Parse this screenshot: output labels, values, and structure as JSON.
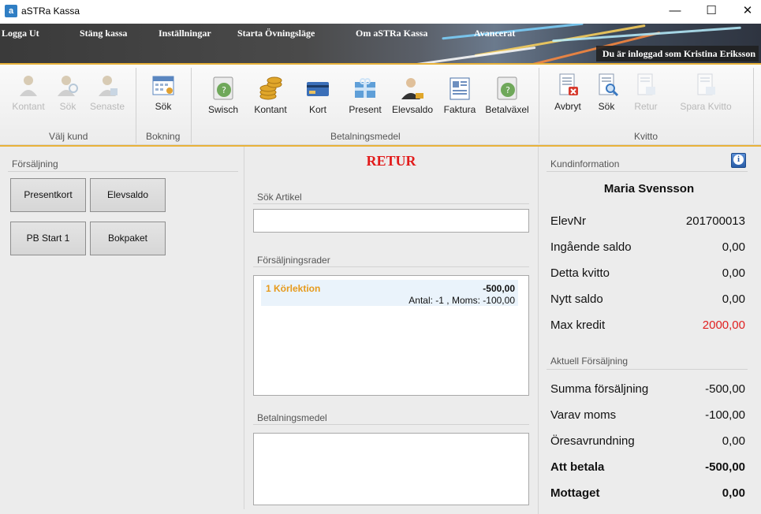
{
  "window": {
    "title": "aSTRa Kassa",
    "app_icon_letter": "a",
    "minimize": "—",
    "maximize": "☐",
    "close": "✕"
  },
  "menu": {
    "items": [
      "Logga Ut",
      "Stäng kassa",
      "Inställningar",
      "Starta Övningsläge",
      "Om aSTRa Kassa",
      "Avancerat"
    ],
    "login_info": "Du är inloggad som Kristina Eriksson"
  },
  "ribbon": {
    "valj_kund": {
      "label": "Välj kund",
      "buttons": [
        "Kontant",
        "Sök",
        "Senaste"
      ]
    },
    "bokning": {
      "label": "Bokning",
      "buttons": [
        "Sök"
      ]
    },
    "betalningsmedel": {
      "label": "Betalningsmedel",
      "buttons": [
        "Swisch",
        "Kontant",
        "Kort",
        "Present",
        "Elevsaldo",
        "Faktura",
        "Betalväxel"
      ]
    },
    "kvitto": {
      "label": "Kvitto",
      "buttons": [
        "Avbryt",
        "Sök",
        "Retur",
        "Spara Kvitto"
      ]
    }
  },
  "sales": {
    "title": "Försäljning",
    "buttons": [
      "Presentkort",
      "Elevsaldo",
      "PB Start 1",
      "Bokpaket"
    ]
  },
  "center": {
    "mode": "RETUR",
    "search_title": "Sök Artikel",
    "search_value": "",
    "rows_title": "Försäljningsrader",
    "rows": [
      {
        "name": "1 Körlektion",
        "amount": "-500,00",
        "detail": "Antal: -1 , Moms: -100,00"
      }
    ],
    "payment_title": "Betalningsmedel"
  },
  "customer": {
    "title": "Kundinformation",
    "name": "Maria Svensson",
    "fields": [
      {
        "label": "ElevNr",
        "value": "201700013"
      },
      {
        "label": "Ingående saldo",
        "value": "0,00"
      },
      {
        "label": "Detta kvitto",
        "value": "0,00"
      },
      {
        "label": "Nytt saldo",
        "value": "0,00"
      },
      {
        "label": "Max kredit",
        "value": "2000,00"
      }
    ],
    "max_credit_color": "#e02020"
  },
  "current_sale": {
    "title": "Aktuell Försäljning",
    "fields": [
      {
        "label": "Summa försäljning",
        "value": "-500,00"
      },
      {
        "label": "Varav moms",
        "value": "-100,00"
      },
      {
        "label": "Öresavrundning",
        "value": "0,00"
      },
      {
        "label": "Att betala",
        "value": "-500,00"
      },
      {
        "label": "Mottaget",
        "value": "0,00"
      }
    ]
  },
  "colors": {
    "accent_gold": "#e8b23a",
    "retur_red": "#e21b1b",
    "row_name_orange": "#e69a1c"
  }
}
